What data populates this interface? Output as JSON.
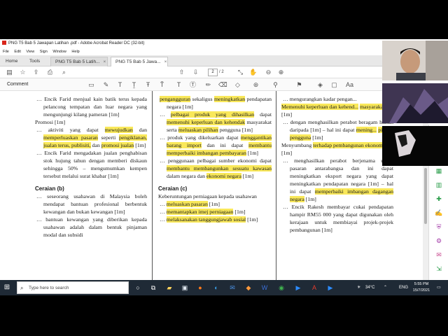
{
  "window": {
    "title": "PNG T5 Bab 5 Jawapan Latihan .pdf - Adobe Acrobat Reader DC (32-bit)",
    "menu": [
      "File",
      "Edit",
      "View",
      "Sign",
      "Window",
      "Help"
    ]
  },
  "tabs": {
    "home": "Home",
    "tools": "Tools",
    "doc1": "PNG T5 Bab 5 Latih...",
    "doc2": "PNG T5 Bab 5 Jawa...",
    "close_glyph": "×"
  },
  "toolbar": {
    "page_current": "2",
    "page_total": "/ 2"
  },
  "comment_bar": {
    "label": "Comment"
  },
  "document": {
    "col1": [
      {
        "id": "c1a",
        "text": "Encik Farid menjual kain batik terus kepada pelancong tempatan dan luar negara yang mengunjungi kilang pameran [1m]"
      },
      {
        "id": "c1b",
        "text": "Promosi [1m]"
      },
      {
        "id": "c1c",
        "pre": "aktiviti yang dapat ",
        "hl1": "mewujudkan",
        "mid1": " dan ",
        "hl2": "memperluaskan pasaran",
        "mid2": " seperti ",
        "hl3": "pengiklanan, jualan terus, publisiti,",
        "mid3": " dan ",
        "hl4": "promosi jualan",
        "post": " [1m]"
      },
      {
        "id": "c1d",
        "text": "Encik Farid mengadakan jualan penghabisan stok hujung tahun dengan memberi diskaun sehingga 50% – mengumumkan kempen tersebut melalui surat khabar [1m]"
      },
      {
        "id": "c1e",
        "text": "Ceraian (b)"
      },
      {
        "id": "c1f",
        "text": "seseorang usahawan di Malaysia boleh mendapat bantuan profesional berbentuk kewangan dan bukan kewangan [1m]"
      },
      {
        "id": "c1g",
        "text": "bantuan kewangan yang diberikan kepada usahawan adalah dalam bentuk pinjaman modal dan subsidi"
      }
    ],
    "col2": [
      {
        "id": "c2a",
        "hl1": "pengangguran",
        "mid1": " sekaligus ",
        "hl2": "meningkatkan",
        "post": " pendapatan negara [1m]"
      },
      {
        "id": "c2b",
        "hl1": "pelbagai produk yang dihasilkan",
        "mid1": " dapat ",
        "hl2": "memenuhi keperluan dan kehendak",
        "mid2": " masyarakat serta ",
        "hl3": "meluaskan pilihan",
        "post": " pengguna [1m]"
      },
      {
        "id": "c2c",
        "pre": "produk yang dikeluarkan dapat ",
        "hl1": "menggantikan barang import",
        "mid1": " dan ini dapat ",
        "hl2": "membantu memperbaiki imbangan pembayaran",
        "post": " [1m]"
      },
      {
        "id": "c2d",
        "pre": "penggunaan pelbagai sumber ekonomi dapat ",
        "hl1": "membantu membangunkan sesuatu kawasan",
        "mid1": " dalam negara dan ",
        "hl2": "ekonomi negara",
        "post": " [1m]"
      },
      {
        "id": "c2e",
        "text": "Ceraian (c)"
      },
      {
        "id": "c2f",
        "text": "Keberuntungan perniagaan kepada usahawan"
      },
      {
        "id": "c2g",
        "hl1": "meluaskan pasaran",
        "post": " [1m]"
      },
      {
        "id": "c2h",
        "hl1": "memantapkan imej perniagaan",
        "post": " [1m]"
      },
      {
        "id": "c2i",
        "hl1": "melaksanakan tanggungjawab sosial",
        "post": " [1m]"
      }
    ],
    "col3": [
      {
        "id": "c3a",
        "text": "mengurangkan kadar pengan..."
      },
      {
        "id": "c3b",
        "hl1": "Memenuhi keperluan dan kehend...",
        "mid1": " ",
        "hl2": "masyarakat",
        "post": " [1m]"
      },
      {
        "id": "c3c",
        "pre": "dengan menghasilkan perabot beragam hiasan daripada [1m] – hal ini dapat ",
        "hl1": "mening...",
        "mid1": " ",
        "hl2": "pilihan pengguna",
        "post": " [1m]"
      },
      {
        "id": "c3d",
        "pre": "Menyumbang ",
        "hl1": "terhadap pembangunan ekonomi",
        "post": " [1m]"
      },
      {
        "id": "c3e",
        "pre": "menghasilkan perabot berjenama untuk pasaran antarabangsa dan ini dapat meningkatkan eksport negara yang dapat meningkatkan pendapatan negara [1m] – hal ini dapat ",
        "hl1": "memperbaiki imbangan dagangan negara",
        "post": " [1m]"
      },
      {
        "id": "c3f",
        "text": "Encik Rakesh membayar cukai pendapatan hampir RM55 000 yang dapat digunakan oleh kerajaan untuk membiayai projek-projek pembangunan [1m]"
      }
    ]
  },
  "taskbar": {
    "search_placeholder": "Type here to search",
    "weather": "34°C",
    "lang": "ENG",
    "time": "5:55 PM",
    "date": "15/7/2021"
  },
  "colors": {
    "highlight": "#f9e85a",
    "taskbar": "#1f2a36",
    "acrobat_red": "#d9261c"
  }
}
